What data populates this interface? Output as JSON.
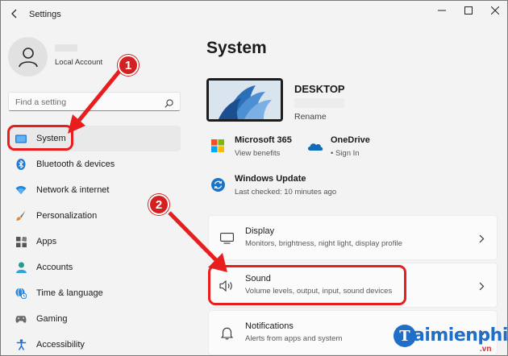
{
  "window": {
    "title": "Settings"
  },
  "account": {
    "subtitle": "Local Account"
  },
  "search": {
    "placeholder": "Find a setting"
  },
  "nav": {
    "items": [
      {
        "label": "System",
        "icon": "system-icon",
        "selected": true
      },
      {
        "label": "Bluetooth & devices",
        "icon": "bluetooth-icon"
      },
      {
        "label": "Network & internet",
        "icon": "wifi-icon"
      },
      {
        "label": "Personalization",
        "icon": "brush-icon"
      },
      {
        "label": "Apps",
        "icon": "apps-icon"
      },
      {
        "label": "Accounts",
        "icon": "person-icon"
      },
      {
        "label": "Time & language",
        "icon": "globe-clock-icon"
      },
      {
        "label": "Gaming",
        "icon": "gamepad-icon"
      },
      {
        "label": "Accessibility",
        "icon": "accessibility-icon"
      }
    ]
  },
  "main": {
    "title": "System",
    "device": {
      "name": "DESKTOP",
      "rename": "Rename"
    },
    "ms365": {
      "title": "Microsoft 365",
      "sub": "View benefits"
    },
    "onedrive": {
      "title": "OneDrive",
      "sub": "• Sign In"
    },
    "update": {
      "title": "Windows Update",
      "sub": "Last checked: 10 minutes ago"
    },
    "cards": [
      {
        "title": "Display",
        "sub": "Monitors, brightness, night light, display profile",
        "icon": "monitor-icon"
      },
      {
        "title": "Sound",
        "sub": "Volume levels, output, input, sound devices",
        "icon": "speaker-icon"
      },
      {
        "title": "Notifications",
        "sub": "Alerts from apps and system",
        "icon": "bell-icon"
      }
    ]
  },
  "annotations": {
    "badge1": "1",
    "badge2": "2"
  },
  "watermark": {
    "logo_letter": "T",
    "text": "aimienphi",
    "suffix": ".vn"
  },
  "colors": {
    "accent": "#0067c0",
    "annotation": "#e81e1e",
    "watermark": "#1f6fc9"
  }
}
